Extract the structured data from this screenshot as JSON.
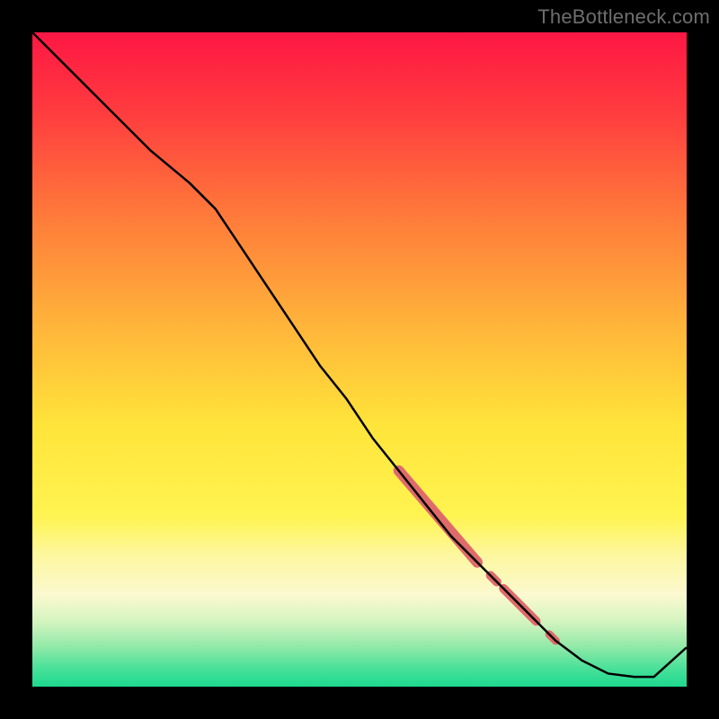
{
  "watermark": "TheBottleneck.com",
  "chart_data": {
    "type": "line",
    "title": "",
    "xlabel": "",
    "ylabel": "",
    "xlim": [
      0,
      100
    ],
    "ylim": [
      0,
      100
    ],
    "grid": false,
    "legend": false,
    "background_gradient": {
      "stops": [
        {
          "t": 0.0,
          "color": "#ff1744"
        },
        {
          "t": 0.12,
          "color": "#ff3b3f"
        },
        {
          "t": 0.28,
          "color": "#ff7a3a"
        },
        {
          "t": 0.45,
          "color": "#ffb53a"
        },
        {
          "t": 0.6,
          "color": "#ffe43a"
        },
        {
          "t": 0.74,
          "color": "#fff451"
        },
        {
          "t": 0.8,
          "color": "#fdf7a0"
        },
        {
          "t": 0.86,
          "color": "#fbf9d0"
        },
        {
          "t": 0.9,
          "color": "#d4f4bf"
        },
        {
          "t": 0.94,
          "color": "#8fe9a8"
        },
        {
          "t": 0.97,
          "color": "#4de19a"
        },
        {
          "t": 1.0,
          "color": "#1cd98f"
        }
      ]
    },
    "series": [
      {
        "name": "curve",
        "color": "#000000",
        "width": 2.5,
        "x": [
          0,
          6,
          12,
          18,
          24,
          28,
          32,
          36,
          40,
          44,
          48,
          52,
          56,
          60,
          64,
          68,
          72,
          76,
          80,
          84,
          88,
          92,
          95,
          100
        ],
        "y": [
          100,
          94,
          88,
          82,
          77,
          73,
          67,
          61,
          55,
          49,
          44,
          38,
          33,
          28,
          23,
          19,
          15,
          11,
          7,
          4,
          2,
          1.5,
          1.5,
          6
        ]
      }
    ],
    "highlights": [
      {
        "start_x": 56,
        "end_x": 68,
        "color": "#e06a6a",
        "width": 12
      },
      {
        "start_x": 70,
        "end_x": 71,
        "color": "#e06a6a",
        "width": 10
      },
      {
        "start_x": 72,
        "end_x": 77,
        "color": "#e06a6a",
        "width": 10
      },
      {
        "start_x": 79,
        "end_x": 80,
        "color": "#e06a6a",
        "width": 9
      }
    ]
  }
}
